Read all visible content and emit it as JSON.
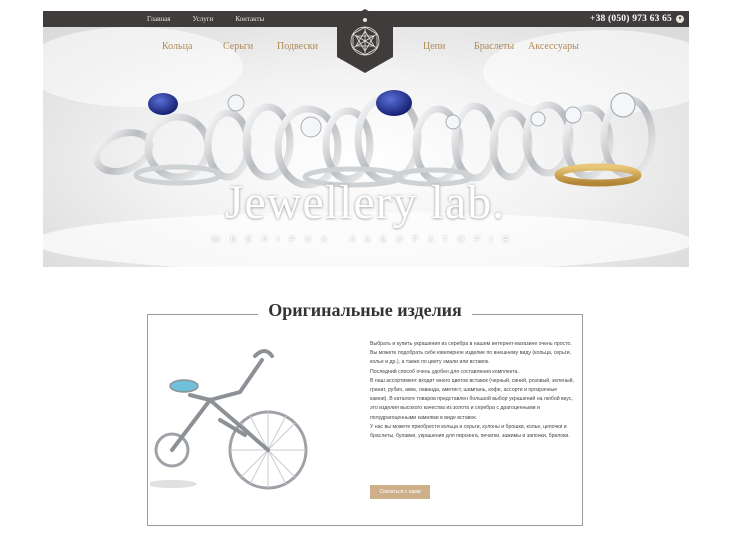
{
  "topbar": {
    "nav": [
      "Главная",
      "Услуги",
      "Контакты"
    ],
    "phone": "+38 (050) 973 63 65",
    "phone_icon": "chevron-circle-icon"
  },
  "menu": {
    "left": [
      "Кольца",
      "Серьги",
      "Подвески"
    ],
    "right": [
      "Цепи",
      "Браслеты",
      "Аксессуары"
    ]
  },
  "hero": {
    "brand": "Jewellery lab.",
    "subtitle": "ЮВЕЛІРНА ЛАБОРАТОРІЯ"
  },
  "section": {
    "title": "Оригинальные изделия",
    "paragraphs": [
      "Выбрать и купить украшения из серебра в нашем интернет-магазине очень просто. Вы можете подобрать себе ювелирное изделие по внешнему виду (кольца, серьги, колье и др.), а также по цвету эмали или вставок.",
      "Последний способ очень удобен для составления комплекта.",
      "В наш ассортимент входит много цветов вставок (черный, синий, розовый, зеленый, гранат, рубин, аква, лаванда, аметист, шампань, кофе, ассорти и прозрачные камни). В каталоге товаров представлен большой выбор украшений на любой вкус, это изделия высокого качества из золота и серебра с драгоценными и полудрагоценными камнями в виде вставок.",
      "У нас вы можете приобрести кольца и серьги, кулоны и брошки, колье, цепочки и браслеты, булавки, украшения для пирсинга, печатки, зажимы и запонки, брелоки."
    ],
    "button": "Связаться с нами"
  },
  "colors": {
    "topbar_bg": "#3f3c3b",
    "accent_gold": "#b08a55",
    "button_bg": "#cdb08a"
  }
}
